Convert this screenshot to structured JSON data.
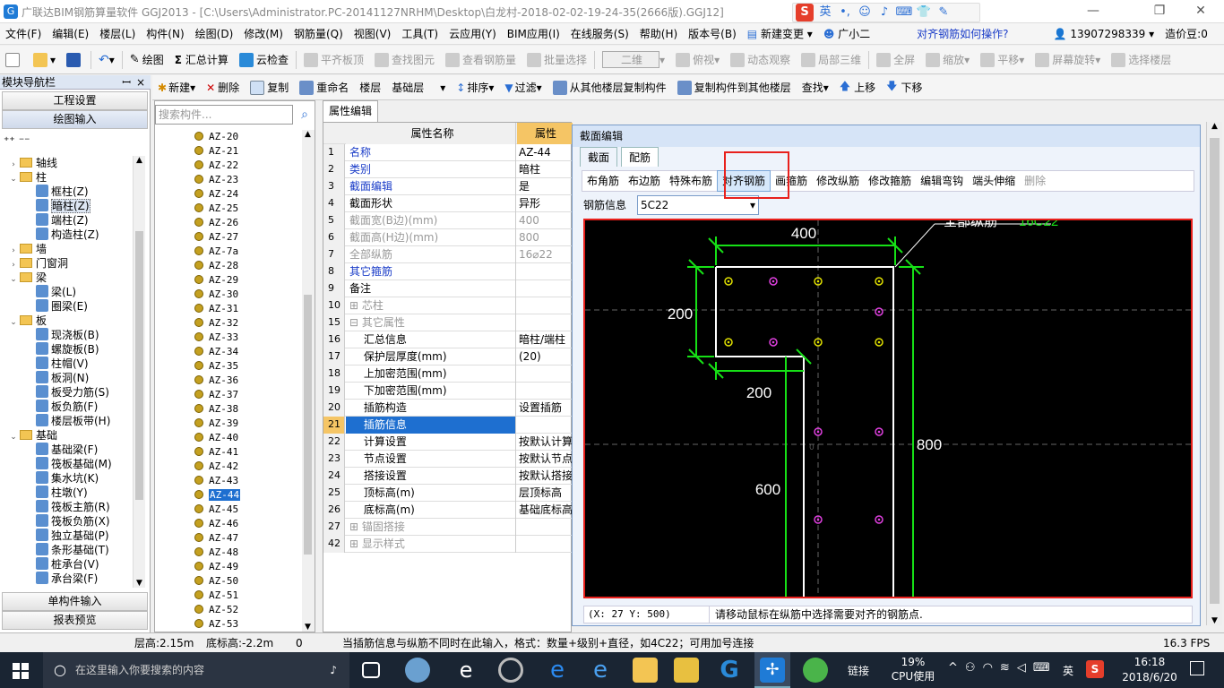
{
  "title_bar": {
    "text": "广联达BIM钢筋算量软件 GGJ2013 - [C:\\Users\\Administrator.PC-20141127NRHM\\Desktop\\白龙村-2018-02-02-19-24-35(2666版).GGJ12]",
    "ime_label": "英"
  },
  "menu": [
    "文件(F)",
    "编辑(E)",
    "楼层(L)",
    "构件(N)",
    "绘图(D)",
    "修改(M)",
    "钢筋量(Q)",
    "视图(V)",
    "工具(T)",
    "云应用(Y)",
    "BIM应用(I)",
    "在线服务(S)",
    "帮助(H)",
    "版本号(B)",
    "新建变更",
    "广小二"
  ],
  "menu_right": {
    "help_link": "对齐钢筋如何操作?",
    "phone": "13907298339",
    "credit": "造价豆:0"
  },
  "toolbar1": {
    "draw": "绘图",
    "sum": "汇总计算",
    "cloud_check": "云检查",
    "flat_top": "平齐板顶",
    "find_elem": "查找图元",
    "view_rebar": "查看钢筋量",
    "batch_select": "批量选择",
    "view_mode": "二维",
    "top_view": "俯视",
    "dynamic": "动态观察",
    "local_3d": "局部三维",
    "full_screen": "全屏",
    "zoom": "缩放",
    "pan": "平移",
    "rotate": "屏幕旋转",
    "select_floor": "选择楼层"
  },
  "toolbar2": {
    "new": "新建",
    "delete": "删除",
    "copy": "复制",
    "rename": "重命名",
    "floor_label": "楼层",
    "floor_value": "基础层",
    "sort": "排序",
    "filter": "过滤",
    "copy_from": "从其他楼层复制构件",
    "copy_to": "复制构件到其他楼层",
    "find": "查找",
    "move_up": "上移",
    "move_down": "下移"
  },
  "nav": {
    "header": "模块导航栏",
    "project_settings": "工程设置",
    "drawing_input": "绘图输入",
    "single_input": "单构件输入",
    "report": "报表预览",
    "tree": [
      {
        "label": "轴线",
        "level": 0,
        "type": "folder",
        "toggle": "›"
      },
      {
        "label": "柱",
        "level": 0,
        "type": "folder",
        "toggle": "⌄"
      },
      {
        "label": "框柱(Z)",
        "level": 1,
        "type": "item"
      },
      {
        "label": "暗柱(Z)",
        "level": 1,
        "type": "item",
        "selected": true
      },
      {
        "label": "端柱(Z)",
        "level": 1,
        "type": "item"
      },
      {
        "label": "构造柱(Z)",
        "level": 1,
        "type": "item"
      },
      {
        "label": "墙",
        "level": 0,
        "type": "folder",
        "toggle": "›"
      },
      {
        "label": "门窗洞",
        "level": 0,
        "type": "folder",
        "toggle": "›"
      },
      {
        "label": "梁",
        "level": 0,
        "type": "folder",
        "toggle": "⌄"
      },
      {
        "label": "梁(L)",
        "level": 1,
        "type": "item"
      },
      {
        "label": "圈梁(E)",
        "level": 1,
        "type": "item"
      },
      {
        "label": "板",
        "level": 0,
        "type": "folder",
        "toggle": "⌄"
      },
      {
        "label": "现浇板(B)",
        "level": 1,
        "type": "item"
      },
      {
        "label": "螺旋板(B)",
        "level": 1,
        "type": "item"
      },
      {
        "label": "柱帽(V)",
        "level": 1,
        "type": "item"
      },
      {
        "label": "板洞(N)",
        "level": 1,
        "type": "item"
      },
      {
        "label": "板受力筋(S)",
        "level": 1,
        "type": "item"
      },
      {
        "label": "板负筋(F)",
        "level": 1,
        "type": "item"
      },
      {
        "label": "楼层板带(H)",
        "level": 1,
        "type": "item"
      },
      {
        "label": "基础",
        "level": 0,
        "type": "folder",
        "toggle": "⌄"
      },
      {
        "label": "基础梁(F)",
        "level": 1,
        "type": "item"
      },
      {
        "label": "筏板基础(M)",
        "level": 1,
        "type": "item"
      },
      {
        "label": "集水坑(K)",
        "level": 1,
        "type": "item"
      },
      {
        "label": "柱墩(Y)",
        "level": 1,
        "type": "item"
      },
      {
        "label": "筏板主筋(R)",
        "level": 1,
        "type": "item"
      },
      {
        "label": "筏板负筋(X)",
        "level": 1,
        "type": "item"
      },
      {
        "label": "独立基础(P)",
        "level": 1,
        "type": "item"
      },
      {
        "label": "条形基础(T)",
        "level": 1,
        "type": "item"
      },
      {
        "label": "桩承台(V)",
        "level": 1,
        "type": "item"
      },
      {
        "label": "承台梁(F)",
        "level": 1,
        "type": "item"
      }
    ]
  },
  "search": {
    "placeholder": "搜索构件..."
  },
  "components": [
    "AZ-20",
    "AZ-21",
    "AZ-22",
    "AZ-23",
    "AZ-24",
    "AZ-25",
    "AZ-26",
    "AZ-27",
    "AZ-7a",
    "AZ-28",
    "AZ-29",
    "AZ-30",
    "AZ-31",
    "AZ-32",
    "AZ-33",
    "AZ-34",
    "AZ-35",
    "AZ-36",
    "AZ-37",
    "AZ-38",
    "AZ-39",
    "AZ-40",
    "AZ-41",
    "AZ-42",
    "AZ-43",
    "AZ-44",
    "AZ-45",
    "AZ-46",
    "AZ-47",
    "AZ-48",
    "AZ-49",
    "AZ-50",
    "AZ-51",
    "AZ-52",
    "AZ-53"
  ],
  "selected_component": "AZ-44",
  "props": {
    "tab": "属性编辑",
    "col_name": "属性名称",
    "col_value": "属性",
    "rows": [
      {
        "n": "1",
        "k": "名称",
        "v": "AZ-44",
        "style": "blue"
      },
      {
        "n": "2",
        "k": "类别",
        "v": "暗柱",
        "style": "blue"
      },
      {
        "n": "3",
        "k": "截面编辑",
        "v": "是",
        "style": "blue"
      },
      {
        "n": "4",
        "k": "截面形状",
        "v": "异形",
        "style": ""
      },
      {
        "n": "5",
        "k": "截面宽(B边)(mm)",
        "v": "400",
        "style": "gray"
      },
      {
        "n": "6",
        "k": "截面高(H边)(mm)",
        "v": "800",
        "style": "gray"
      },
      {
        "n": "7",
        "k": "全部纵筋",
        "v": "16⌀22",
        "style": "gray"
      },
      {
        "n": "8",
        "k": "其它箍筋",
        "v": "",
        "style": "blue"
      },
      {
        "n": "9",
        "k": "备注",
        "v": "",
        "style": ""
      },
      {
        "n": "10",
        "k": "⊞ 芯柱",
        "v": "",
        "style": "gray"
      },
      {
        "n": "15",
        "k": "⊟ 其它属性",
        "v": "",
        "style": "gray"
      },
      {
        "n": "16",
        "k": "　 汇总信息",
        "v": "暗柱/端柱",
        "style": ""
      },
      {
        "n": "17",
        "k": "　 保护层厚度(mm)",
        "v": "(20)",
        "style": ""
      },
      {
        "n": "18",
        "k": "　 上加密范围(mm)",
        "v": "",
        "style": ""
      },
      {
        "n": "19",
        "k": "　 下加密范围(mm)",
        "v": "",
        "style": ""
      },
      {
        "n": "20",
        "k": "　 插筋构造",
        "v": "设置插筋",
        "style": ""
      },
      {
        "n": "21",
        "k": "　 插筋信息",
        "v": "",
        "style": "",
        "selected": true
      },
      {
        "n": "22",
        "k": "　 计算设置",
        "v": "按默认计算",
        "style": ""
      },
      {
        "n": "23",
        "k": "　 节点设置",
        "v": "按默认节点",
        "style": ""
      },
      {
        "n": "24",
        "k": "　 搭接设置",
        "v": "按默认搭接",
        "style": ""
      },
      {
        "n": "25",
        "k": "　 顶标高(m)",
        "v": "层顶标高",
        "style": ""
      },
      {
        "n": "26",
        "k": "　 底标高(m)",
        "v": "基础底标高",
        "style": ""
      },
      {
        "n": "27",
        "k": "⊞ 锚固搭接",
        "v": "",
        "style": "gray"
      },
      {
        "n": "42",
        "k": "⊞ 显示样式",
        "v": "",
        "style": "gray"
      }
    ]
  },
  "dialog": {
    "title": "截面编辑",
    "tab_section": "截面",
    "tab_rebar": "配筋",
    "ops": [
      "布角筋",
      "布边筋",
      "特殊布筋",
      "对齐钢筋",
      "画箍筋",
      "修改纵筋",
      "修改箍筋",
      "编辑弯钩",
      "端头伸缩",
      "删除"
    ],
    "rebar_info_label": "钢筋信息",
    "rebar_info_value": "5C22",
    "canvas": {
      "dim_top": "400",
      "dim_left": "200",
      "dim_mid": "200",
      "dim_right": "800",
      "dim_bottom": "600",
      "callout": "全部纵筋",
      "callout_value": "16C22"
    },
    "coords": "(X: 27 Y: 500)",
    "hint": "请移动鼠标在纵筋中选择需要对齐的钢筋点."
  },
  "status": {
    "floor_height": "层高:2.15m",
    "bottom_elev": "底标高:-2.2m",
    "zero": "0",
    "message": "当插筋信息与纵筋不同时在此输入，格式：数量+级别+直径，如4C22；可用加号连接",
    "fps": "16.3 FPS"
  },
  "taskbar": {
    "search": "在这里输入你要搜索的内容",
    "link": "链接",
    "cpu_pct": "19%",
    "cpu_label": "CPU使用",
    "lang": "英",
    "time": "16:18",
    "date": "2018/6/20"
  }
}
